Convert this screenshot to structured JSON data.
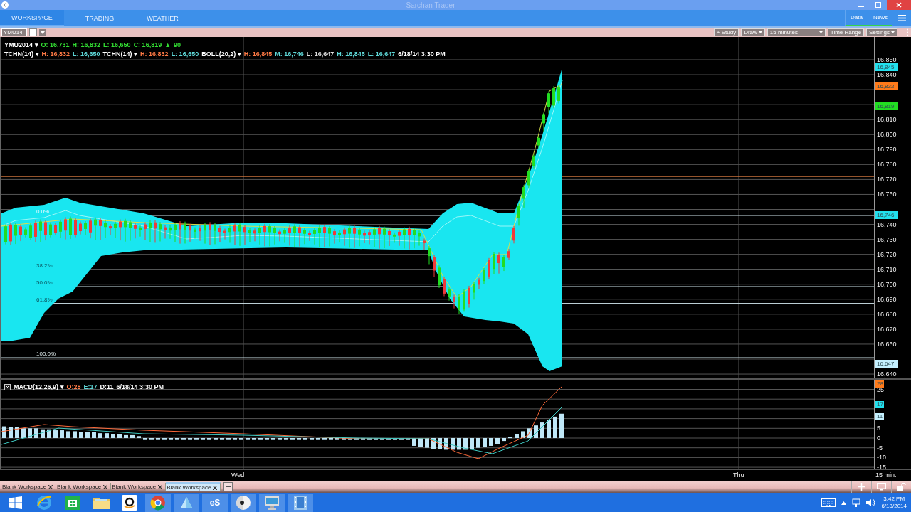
{
  "window": {
    "title": "Sarchan Trader"
  },
  "nav_tabs": [
    {
      "label": "WORKSPACE",
      "selected": true
    },
    {
      "label": "TRADING",
      "selected": false
    },
    {
      "label": "WEATHER",
      "selected": false
    }
  ],
  "panel_tabs": [
    {
      "label": "Data",
      "selected": true
    },
    {
      "label": "News",
      "selected": true
    }
  ],
  "toolbar": {
    "symbol": "YMU14",
    "buttons": [
      {
        "label": "+ Study",
        "kind": "button"
      },
      {
        "label": "Draw",
        "kind": "menu"
      },
      {
        "label": "15 minutes",
        "kind": "select"
      },
      {
        "label": "Time Range",
        "kind": "button"
      },
      {
        "label": "Settings",
        "kind": "menu"
      }
    ]
  },
  "price_legend": [
    {
      "segments": [
        {
          "text": "YMU2014 ▾",
          "color": "#ffffff"
        },
        {
          "text": "O: 16,731",
          "color": "#33dd33"
        },
        {
          "text": "H: 16,832",
          "color": "#33dd33"
        },
        {
          "text": "L: 16,650",
          "color": "#33dd33"
        },
        {
          "text": "C: 16,819",
          "color": "#33dd33"
        },
        {
          "text": "▲",
          "color": "#33dd33"
        },
        {
          "text": "90",
          "color": "#33dd33"
        }
      ]
    },
    {
      "segments": [
        {
          "text": "TCHN(14) ▾",
          "color": "#ffffff"
        },
        {
          "text": "H: 16,832",
          "color": "#ff7a45"
        },
        {
          "text": "L: 16,650",
          "color": "#5fd8d8"
        },
        {
          "text": "TCHN(14) ▾",
          "color": "#ffffff"
        },
        {
          "text": "H: 16,832",
          "color": "#ff7a45"
        },
        {
          "text": "L: 16,650",
          "color": "#5fd8d8"
        },
        {
          "text": "BOLL(20,2) ▾",
          "color": "#ffffff"
        },
        {
          "text": "H: 16,845",
          "color": "#ff7a45"
        },
        {
          "text": "M: 16,746",
          "color": "#5fd8d8"
        },
        {
          "text": "L: 16,647",
          "color": "#dddddd"
        },
        {
          "text": "H: 16,845",
          "color": "#5fd8d8"
        },
        {
          "text": "L: 16,647",
          "color": "#5fd8d8"
        },
        {
          "text": "6/18/14 3:30 PM",
          "color": "#ffffff"
        }
      ]
    }
  ],
  "fib_labels": [
    "0.0%",
    "38.2%",
    "50.0%",
    "61.8%",
    "100.0%"
  ],
  "price_axis": {
    "labels": [
      "16,850",
      "16,840",
      "16,810",
      "16,800",
      "16,790",
      "16,780",
      "16,770",
      "16,760",
      "16,740",
      "16,730",
      "16,720",
      "16,710",
      "16,700",
      "16,690",
      "16,680",
      "16,670",
      "16,660",
      "16,640"
    ],
    "tags": [
      {
        "text": "16,845",
        "color": "#22e0ee"
      },
      {
        "text": "16,832",
        "color": "#ff7a1a"
      },
      {
        "text": "16,819",
        "color": "#22dd22"
      },
      {
        "text": "16,746",
        "color": "#22e0ee"
      },
      {
        "text": "16,647",
        "color": "#c4f0ff"
      }
    ]
  },
  "macd_legend": [
    {
      "text": "MACD(12,26,9) ▾",
      "color": "#ffffff"
    },
    {
      "text": "O:28",
      "color": "#ff7a45"
    },
    {
      "text": "E:17",
      "color": "#5fd8d8"
    },
    {
      "text": "D:11",
      "color": "#ffffff"
    },
    {
      "text": "6/18/14 3:30 PM",
      "color": "#ffffff"
    }
  ],
  "macd_axis": {
    "labels": [
      "25",
      "5",
      "0",
      "-5",
      "-10",
      "-15"
    ],
    "tags": [
      {
        "text": "28",
        "color": "#ff7a1a"
      },
      {
        "text": "17",
        "color": "#22e0ee"
      },
      {
        "text": "11",
        "color": "#c4f0ff"
      }
    ]
  },
  "time_axis": {
    "labels": [
      "Wed",
      "Thu"
    ],
    "interval": "15 min."
  },
  "workspace_tabs": [
    {
      "label": "Blank Workspace",
      "selected": false
    },
    {
      "label": "Blank Workspace",
      "selected": false
    },
    {
      "label": "Blank Workspace",
      "selected": false
    },
    {
      "label": "Blank Workspace",
      "selected": true
    }
  ],
  "taskbar": {
    "apps": [
      {
        "kind": "windows"
      },
      {
        "kind": "browser-e"
      },
      {
        "kind": "store"
      },
      {
        "kind": "folder"
      },
      {
        "kind": "shop"
      },
      {
        "kind": "chrome"
      },
      {
        "kind": "glass"
      },
      {
        "kind": "text",
        "label": "eS"
      },
      {
        "kind": "disc"
      },
      {
        "kind": "computer"
      },
      {
        "kind": "film"
      }
    ],
    "clock": {
      "time": "3:42 PM",
      "date": "6/18/2014"
    }
  }
}
